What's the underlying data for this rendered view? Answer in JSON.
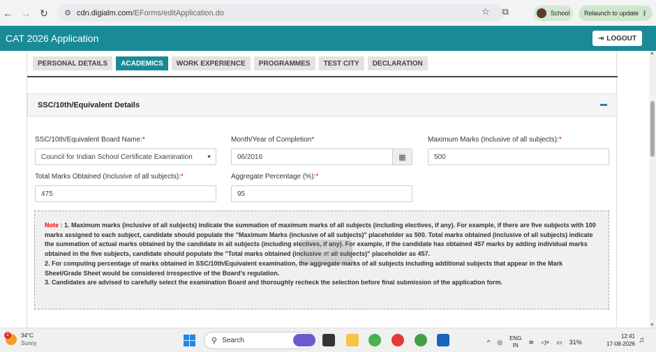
{
  "browser": {
    "url_host": "cdn.digialm.com",
    "url_path": "/EForms/editApplication.do",
    "profile_label": "School",
    "relaunch_label": "Relaunch to update"
  },
  "app": {
    "title": "CAT 2026 Application",
    "logout_label": "LOGOUT"
  },
  "tabs": [
    {
      "label": "PERSONAL DETAILS",
      "active": false
    },
    {
      "label": "ACADEMICS",
      "active": true
    },
    {
      "label": "WORK EXPERIENCE",
      "active": false
    },
    {
      "label": "PROGRAMMES",
      "active": false
    },
    {
      "label": "TEST CITY",
      "active": false
    },
    {
      "label": "DECLARATION",
      "active": false
    }
  ],
  "section": {
    "title": "SSC/10th/Equivalent Details",
    "collapse_symbol": "−"
  },
  "fields": {
    "board_label": "SSC/10th/Equivalent Board Name:",
    "board_value": "Council for Indian School Certificate Examination",
    "completion_label": "Month/Year of Completion",
    "completion_value": "06/2016",
    "max_marks_label": "Maximum Marks (Inclusive of all subjects):",
    "max_marks_value": "500",
    "total_marks_label": "Total Marks Obtained (Inclusive of all subjects):",
    "total_marks_value": "475",
    "aggregate_label": "Aggregate Percentage (%):",
    "aggregate_value": "95",
    "required_mark": "*"
  },
  "note": {
    "prefix": "Note : ",
    "line1": "1. Maximum marks (inclusive of all subjects) indicate the summation of maximum marks of all subjects (including electives, if any). For example, if there are five subjects with 100 marks assigned to each subject, candidate should populate the \"Maximum Marks (inclusive of all subjects)\" placeholder as 500. Total marks obtained (inclusive of all subjects) indicate the summation of actual marks obtained by the candidate in all subjects (including electives, if any). For example, if the candidate has obtained 457 marks by adding individual marks obtained in the five subjects, candidate should populate the \"Total marks obtained (inclusive of all subjects)\" placeholder as 457.",
    "line2": "2. For computing percentage of marks obtained in SSC/10th/Equivalent examination, the aggregate marks of all subjects including additional subjects that appear in the Mark Sheet/Grade Sheet would be considered irrespective of the Board's regulation.",
    "line3": "3. Candidates are advised to carefully select the examination Board and thoroughly recheck the selection before final submission of the application form."
  },
  "taskbar": {
    "weather_badge": "2",
    "temperature": "34°C",
    "condition": "Sunny",
    "search_placeholder": "Search",
    "lang_line1": "ENG",
    "lang_line2": "IN",
    "battery": "31%",
    "time": "12:41",
    "date": "17-08-2026"
  },
  "colors": {
    "teal": "#1a8a96",
    "required": "#e00000"
  }
}
